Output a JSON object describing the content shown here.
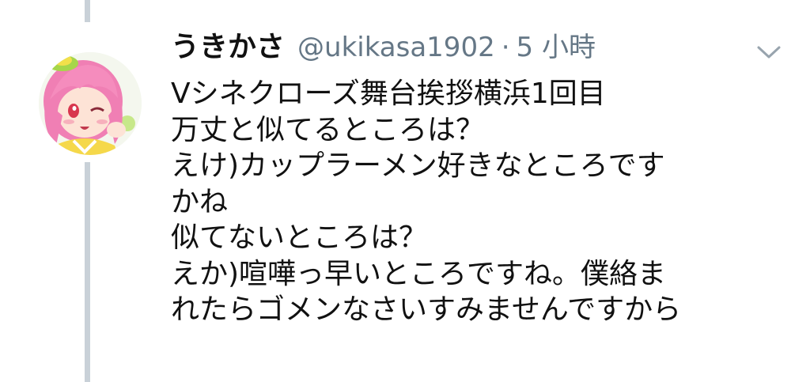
{
  "tweet": {
    "display_name": "うきかさ",
    "handle": "@ukikasa1902",
    "separator": "·",
    "time": "5 小時",
    "lines": [
      "Vシネクローズ舞台挨拶横浜1回目",
      "万丈と似てるところは？",
      "えけ)カップラーメン好きなところです",
      "かね",
      "似てないところは？",
      "えか)喧嘩っ早いところですね。僕絡ま",
      "れたらゴメンなさいすみませんですから"
    ]
  },
  "icons": {
    "menu": "chevron-down-icon",
    "avatar": "anime-avatar"
  },
  "colors": {
    "text": "#111111",
    "muted": "#657786",
    "thread_line": "#c9d1d8",
    "avatar_hair": "#f07fb4"
  }
}
